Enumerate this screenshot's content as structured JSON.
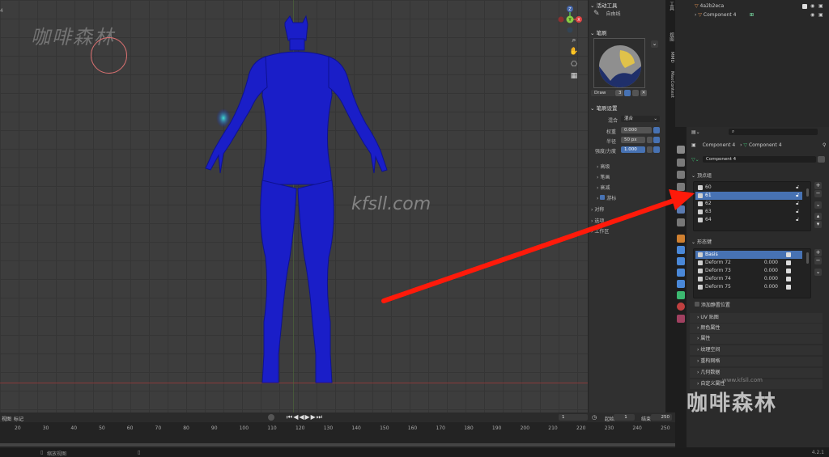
{
  "viewport": {
    "view_number": "4",
    "watermark_cn": "咖啡森林",
    "watermark_url": "kfsll.com"
  },
  "gizmo": {
    "x": "X",
    "y": "Y",
    "z": "Z"
  },
  "tool_panel": {
    "active_tool_title": "活动工具",
    "active_tool_name": "自由线",
    "brush_title": "笔刷",
    "brush_name": "Draw",
    "brush_users": "3",
    "brush_settings_title": "笔刷设置",
    "blend_label": "混合",
    "blend_value": "混合",
    "weight_label": "权重",
    "weight_value": "0.000",
    "radius_label": "半径",
    "radius_value": "50 px",
    "strength_label": "强度/力度",
    "strength_value": "1.000",
    "advanced": "高级",
    "stroke": "笔画",
    "falloff": "衰减",
    "cursor": "游标",
    "symmetry": "对称",
    "options": "选项",
    "workspace": "工作区"
  },
  "side_tabs": [
    "工具",
    "视图",
    "MMD",
    "MaxContext"
  ],
  "outliner": {
    "row1": "4a2b2eca",
    "row2": "Component 4"
  },
  "properties": {
    "search_placeholder": "",
    "breadcrumb_object": "Component 4",
    "breadcrumb_mesh": "Component 4",
    "mesh_name": "Component 4",
    "vertex_groups_title": "顶点组",
    "vertex_groups": [
      "60",
      "61",
      "62",
      "63",
      "64"
    ],
    "shape_keys_title": "形态键",
    "shape_keys": [
      {
        "name": "Basis",
        "value": ""
      },
      {
        "name": "Deform 72",
        "value": "0.000"
      },
      {
        "name": "Deform 73",
        "value": "0.000"
      },
      {
        "name": "Deform 74",
        "value": "0.000"
      },
      {
        "name": "Deform 75",
        "value": "0.000"
      }
    ],
    "shape_key_relative": "添加静置位置",
    "panels": [
      "UV 贴图",
      "颜色属性",
      "属性",
      "纹理空间",
      "重构网格",
      "几何数据",
      "自定义属性"
    ]
  },
  "timeline": {
    "view_label": "视图",
    "marker_label": "标记",
    "current_frame": "1",
    "start_label": "起始",
    "start_value": "1",
    "end_label": "结束",
    "end_value": "250",
    "ticks": [
      "20",
      "30",
      "40",
      "50",
      "60",
      "70",
      "80",
      "90",
      "100",
      "110",
      "120",
      "130",
      "140",
      "150",
      "160",
      "170",
      "180",
      "190",
      "200",
      "210",
      "220",
      "230",
      "240",
      "250"
    ]
  },
  "statusbar": {
    "hint": "缩放视图",
    "version": "4.2.1"
  },
  "watermarks": {
    "bottom_cn": "咖啡森林",
    "bottom_url": "www.kfsll.com"
  },
  "colors": {
    "model": "#1a1ec8",
    "accent": "#4772b3",
    "arrow": "#ff1a0a"
  }
}
